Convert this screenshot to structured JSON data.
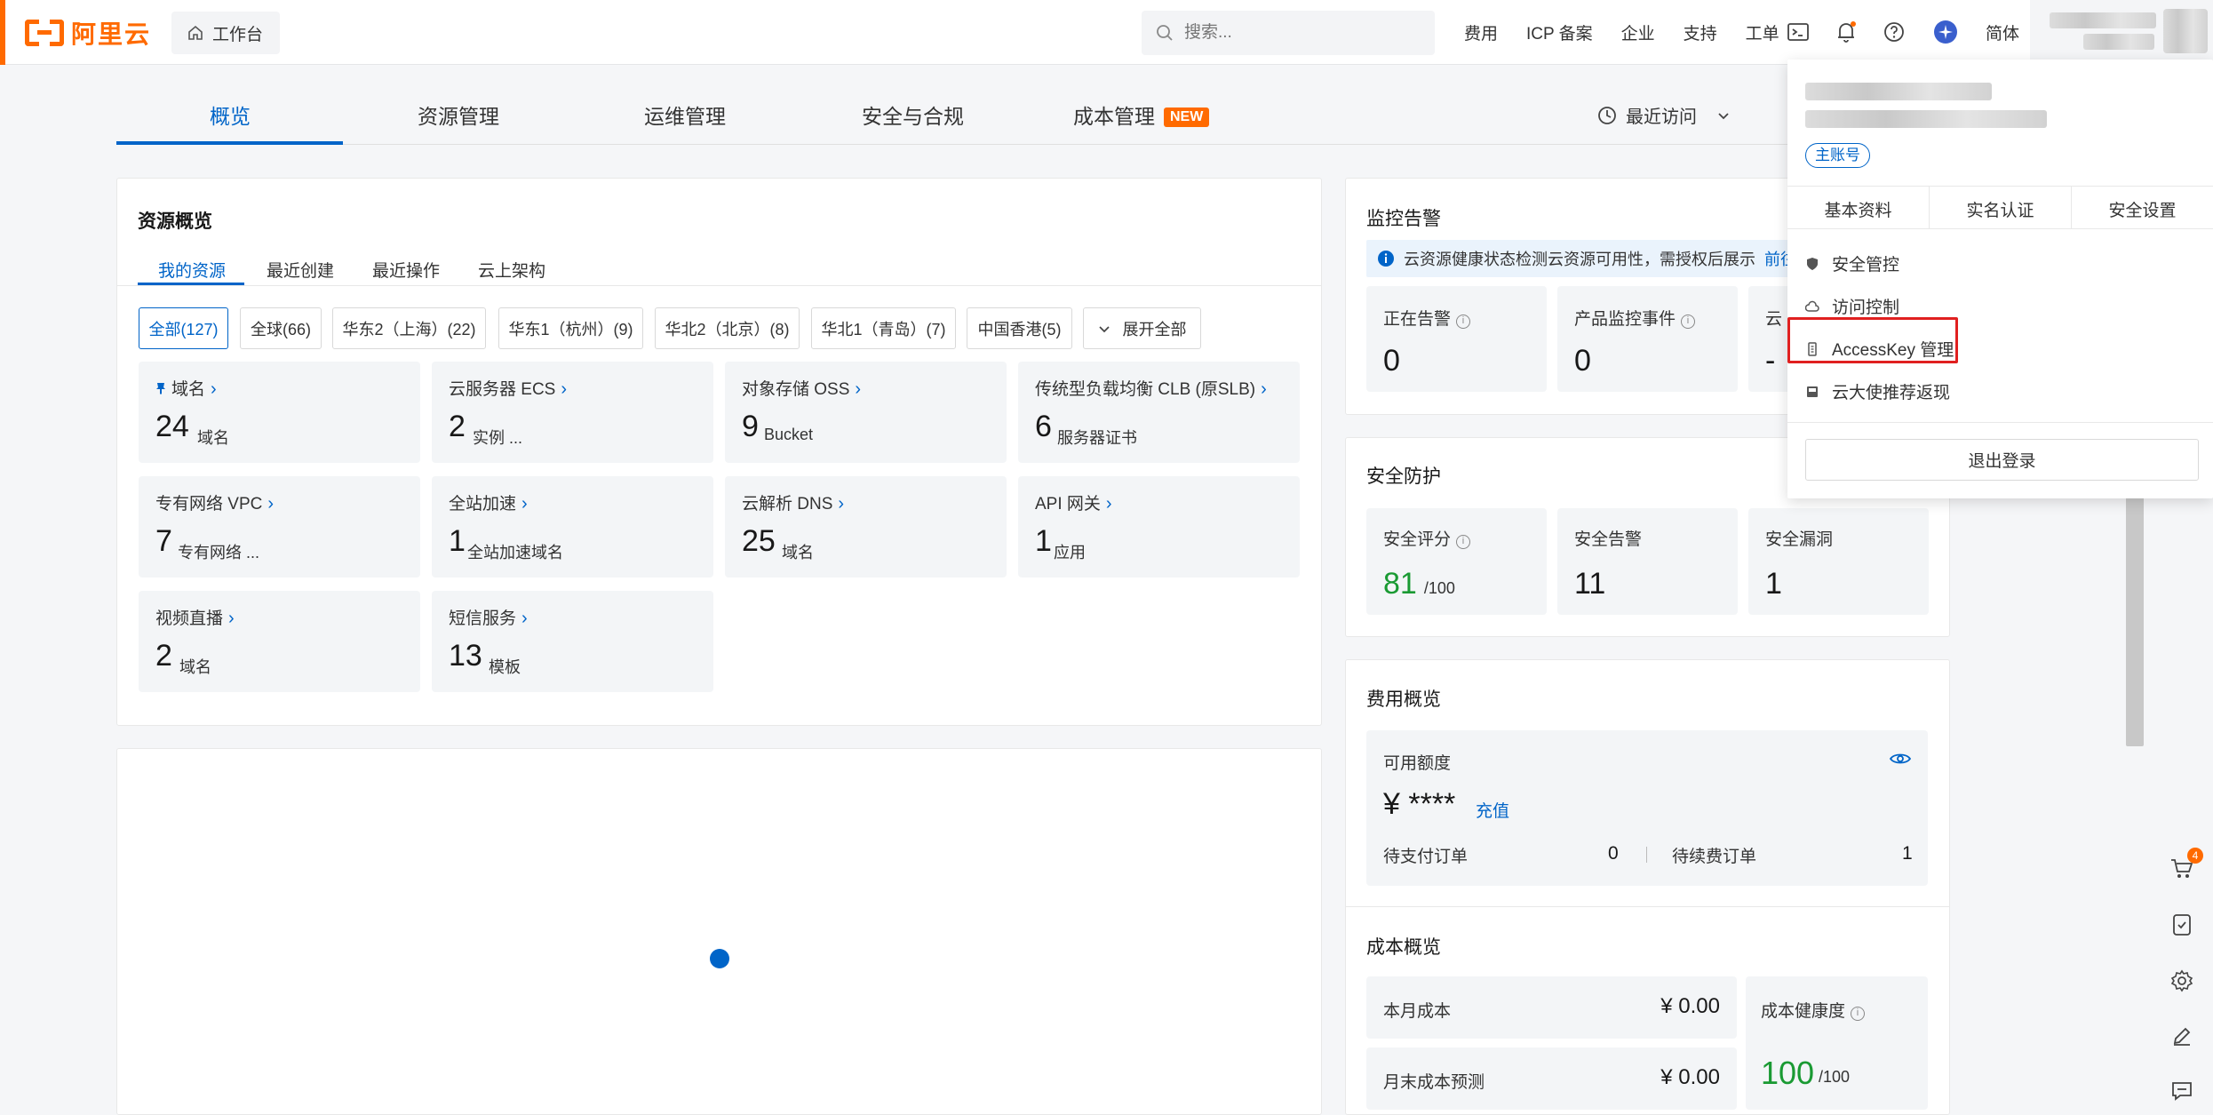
{
  "header": {
    "logo_text": "阿里云",
    "workbench": "工作台",
    "search_placeholder": "搜索...",
    "links": [
      "费用",
      "ICP 备案",
      "企业",
      "支持",
      "工单"
    ],
    "lang": "简体",
    "notification_dot_color": "#ff6a00"
  },
  "tabs": [
    {
      "label": "概览",
      "active": true
    },
    {
      "label": "资源管理"
    },
    {
      "label": "运维管理"
    },
    {
      "label": "安全与合规"
    },
    {
      "label": "成本管理",
      "badge": "NEW"
    }
  ],
  "recent_visit": "最近访问",
  "resources": {
    "title": "资源概览",
    "subtabs": [
      "我的资源",
      "最近创建",
      "最近操作",
      "云上架构"
    ],
    "regions": [
      "全部(127)",
      "全球(66)",
      "华东2（上海）(22)",
      "华东1（杭州）(9)",
      "华北2（北京）(8)",
      "华北1（青岛）(7)",
      "中国香港(5)"
    ],
    "expand_all": "展开全部",
    "tiles": [
      {
        "label": "域名",
        "value": "24",
        "unit": "域名"
      },
      {
        "label": "云服务器 ECS",
        "value": "2",
        "unit": "实例 ..."
      },
      {
        "label": "对象存储 OSS",
        "value": "9",
        "unit": "Bucket"
      },
      {
        "label": "传统型负载均衡 CLB (原SLB)",
        "value": "6",
        "unit": "服务器证书"
      },
      {
        "label": "专有网络 VPC",
        "value": "7",
        "unit": "专有网络 ..."
      },
      {
        "label": "全站加速",
        "value": "1",
        "unit": "全站加速域名"
      },
      {
        "label": "云解析 DNS",
        "value": "25",
        "unit": "域名"
      },
      {
        "label": "API 网关",
        "value": "1",
        "unit": "应用"
      },
      {
        "label": "视频直播",
        "value": "2",
        "unit": "域名"
      },
      {
        "label": "短信服务",
        "value": "13",
        "unit": "模板"
      }
    ]
  },
  "monitor": {
    "title": "监控告警",
    "notice": "云资源健康状态检测云资源可用性，需授权后展示",
    "notice_link": "前往",
    "metrics": [
      {
        "label": "正在告警",
        "value": "0"
      },
      {
        "label": "产品监控事件",
        "value": "0"
      },
      {
        "label": "云",
        "value": "-"
      }
    ]
  },
  "security": {
    "title": "安全防护",
    "score_label": "安全评分",
    "score": "81",
    "score_max": "/100",
    "alerts_label": "安全告警",
    "alerts": "11",
    "vuln_label": "安全漏洞",
    "vuln": "1",
    "score_color": "#1a9a33"
  },
  "billing": {
    "title": "费用概览",
    "available_label": "可用额度",
    "available_value": "¥ ****",
    "recharge": "充值",
    "pending_pay_label": "待支付订单",
    "pending_pay": "0",
    "pending_renew_label": "待续费订单",
    "pending_renew": "1"
  },
  "cost": {
    "title": "成本概览",
    "month_label": "本月成本",
    "month_value": "¥ 0.00",
    "forecast_label": "月末成本预测",
    "forecast_value": "¥ 0.00",
    "health_label": "成本健康度",
    "health_value": "100",
    "health_max": "/100"
  },
  "account_menu": {
    "account_tag": "主账号",
    "tabs": [
      "基本资料",
      "实名认证",
      "安全设置"
    ],
    "items": [
      "安全管控",
      "访问控制",
      "AccessKey 管理",
      "云大使推荐返现"
    ],
    "highlighted_item": "AccessKey 管理",
    "logout": "退出登录"
  },
  "cart_badge": "4",
  "colors": {
    "brand": "#ff6a00",
    "primary": "#0064c8",
    "highlight_box": "#e02020"
  }
}
